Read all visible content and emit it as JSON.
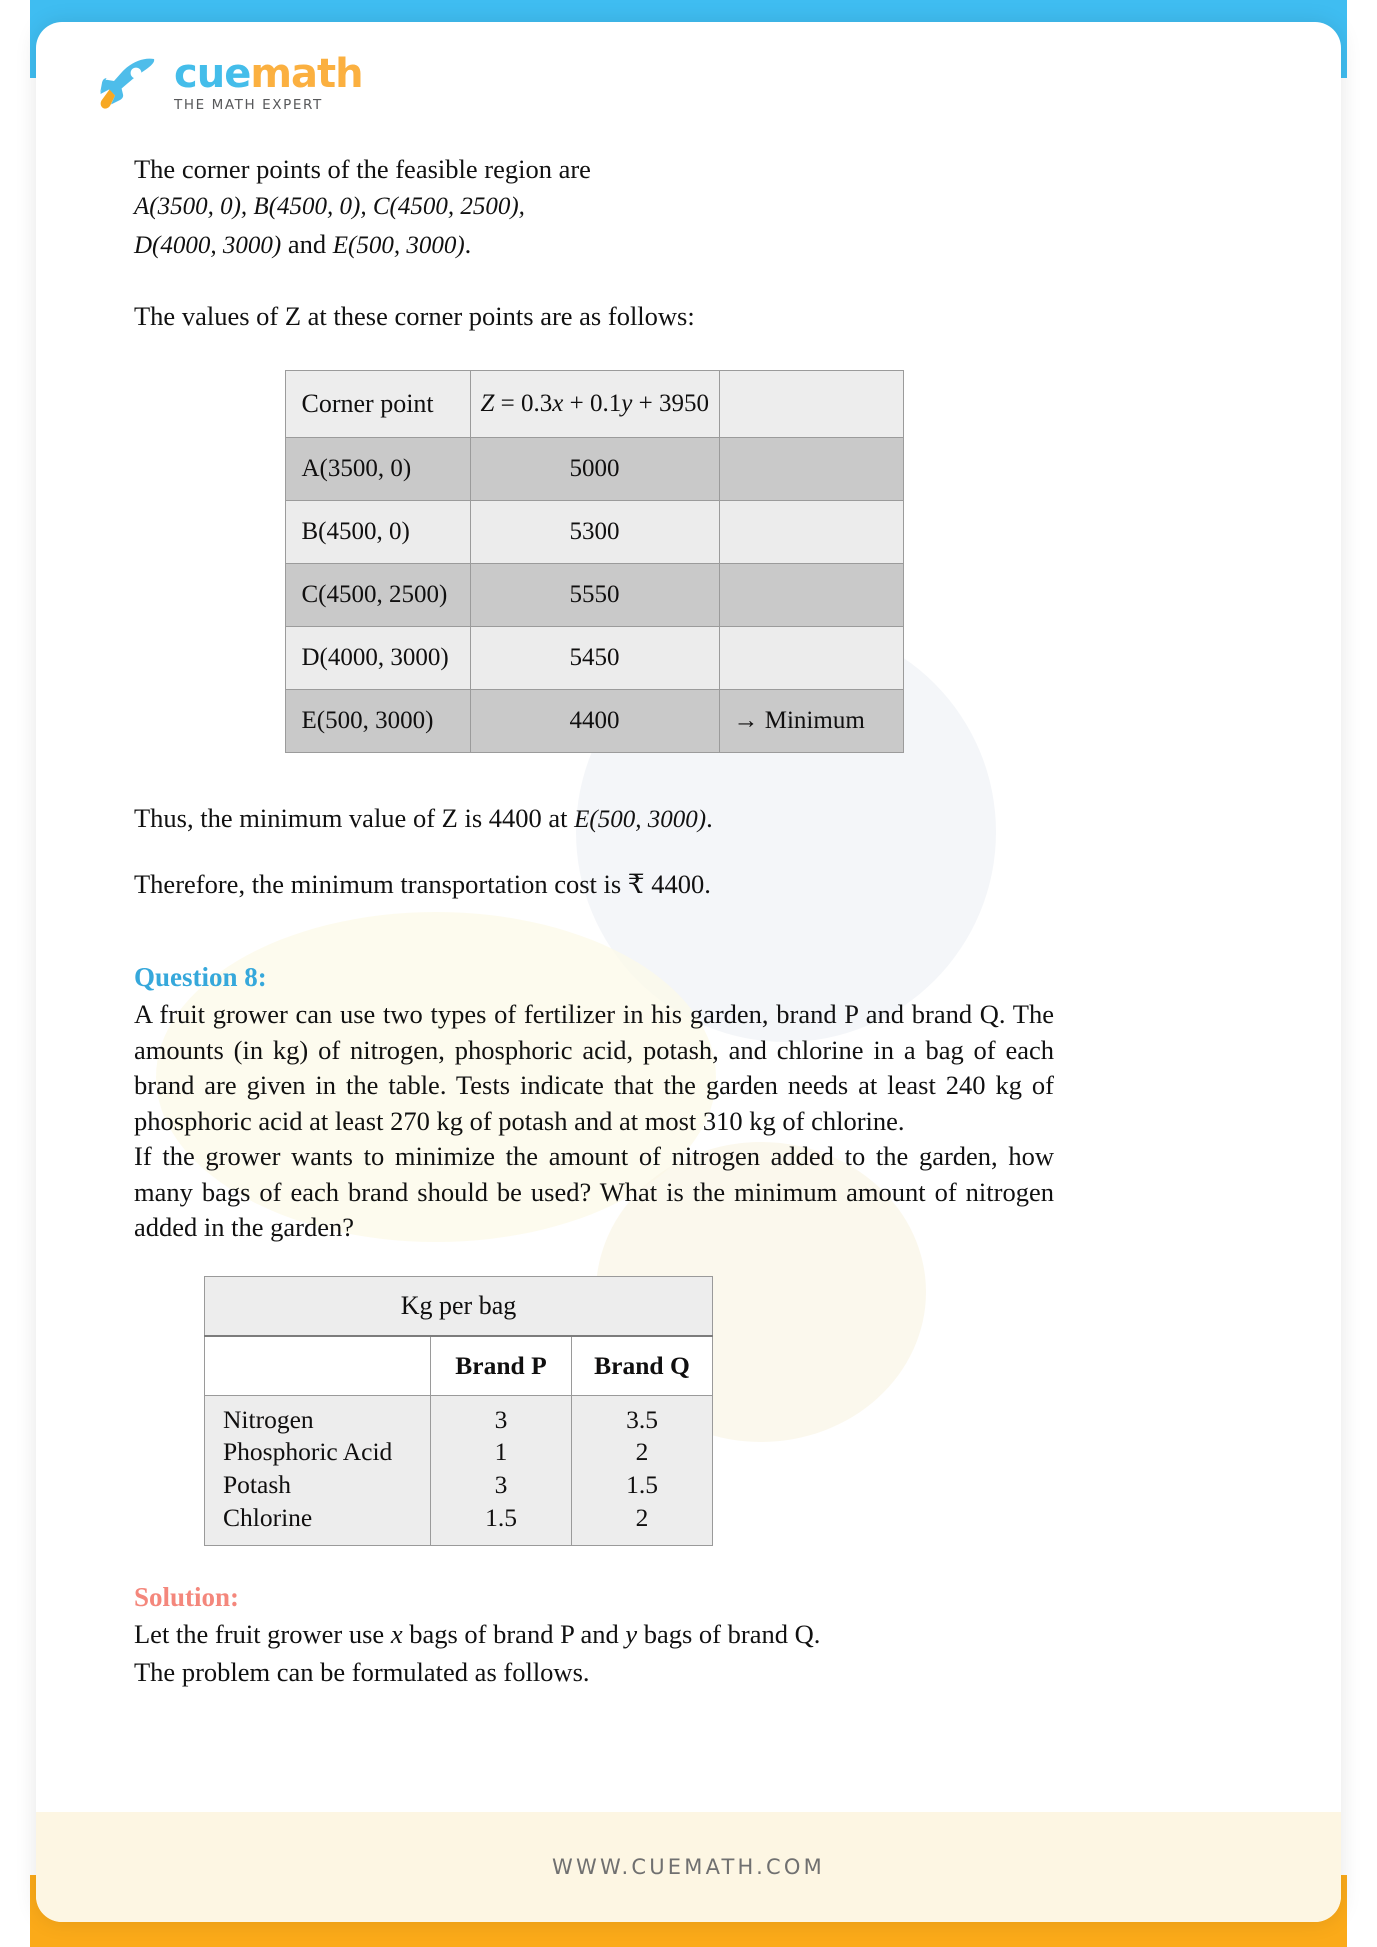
{
  "brand": {
    "logo_cue": "cue",
    "logo_math": "math",
    "tagline": "THE MATH EXPERT",
    "accent_blue": "#44bdea",
    "accent_orange": "#fbb040",
    "question_heading_color": "#36a8db",
    "solution_heading_color": "#f4877c"
  },
  "frame": {
    "top_bar_color": "#3fbdf1",
    "bottom_bar_color": "#fbaa19",
    "footer_bg": "#fdf6e3"
  },
  "intro": {
    "line1_text": "The  corner  points  of  the  feasible  region  are",
    "line1_math": "A(3500, 0), B(4500, 0), C(4500, 2500),",
    "line2_math_a": "D(4000, 3000)",
    "line2_and": "and",
    "line2_math_b": "E(500, 3000)",
    "line2_period": ".",
    "values_line": "The values of Z at these corner points are as follows:"
  },
  "table1": {
    "headers": [
      "Corner point",
      "Z = 0.3x + 0.1y + 3950",
      ""
    ],
    "rows": [
      {
        "point": "A(3500, 0)",
        "z": "5000",
        "note": ""
      },
      {
        "point": "B(4500, 0)",
        "z": "5300",
        "note": ""
      },
      {
        "point": "C(4500, 2500)",
        "z": "5550",
        "note": ""
      },
      {
        "point": "D(4000, 3000)",
        "z": "5450",
        "note": ""
      },
      {
        "point": "E(500, 3000)",
        "z": "4400",
        "note": "→ Minimum"
      }
    ]
  },
  "conclusion": {
    "thus_prefix": "Thus, the minimum value of Z is 4400 at",
    "thus_math": "E(500, 3000)",
    "thus_period": ".",
    "cost_line": "Therefore, the minimum transportation cost is ₹ 4400."
  },
  "question": {
    "heading": "Question 8:",
    "para1": "A fruit grower can use two types of fertilizer in his garden, brand P and brand Q. The amounts (in kg) of nitrogen, phosphoric acid, potash, and chlorine in a bag of each brand are given in the table. Tests indicate that the garden needs at least 240 kg of phosphoric acid at least 270 kg of potash and at most 310 kg of chlorine.",
    "para2": "If the grower wants to minimize the amount of nitrogen added to the garden, how many bags of each brand should be used? What is the minimum amount of nitrogen added in the garden?"
  },
  "table2": {
    "span_header": "Kg per bag",
    "col_headers": [
      "",
      "Brand P",
      "Brand Q"
    ],
    "rows": [
      {
        "nutrient": "Nitrogen",
        "brand_p": "3",
        "brand_q": "3.5"
      },
      {
        "nutrient": "Phosphoric Acid",
        "brand_p": "1",
        "brand_q": "2"
      },
      {
        "nutrient": "Potash",
        "brand_p": "3",
        "brand_q": "1.5"
      },
      {
        "nutrient": "Chlorine",
        "brand_p": "1.5",
        "brand_q": "2"
      }
    ]
  },
  "solution": {
    "heading": "Solution:",
    "line1_a": "Let the fruit grower use",
    "line1_x": "x",
    "line1_b": "bags of brand P and",
    "line1_y": "y",
    "line1_c": "bags of brand Q.",
    "line2": "The problem can be formulated as follows."
  },
  "footer": {
    "url": "WWW.CUEMATH.COM"
  }
}
